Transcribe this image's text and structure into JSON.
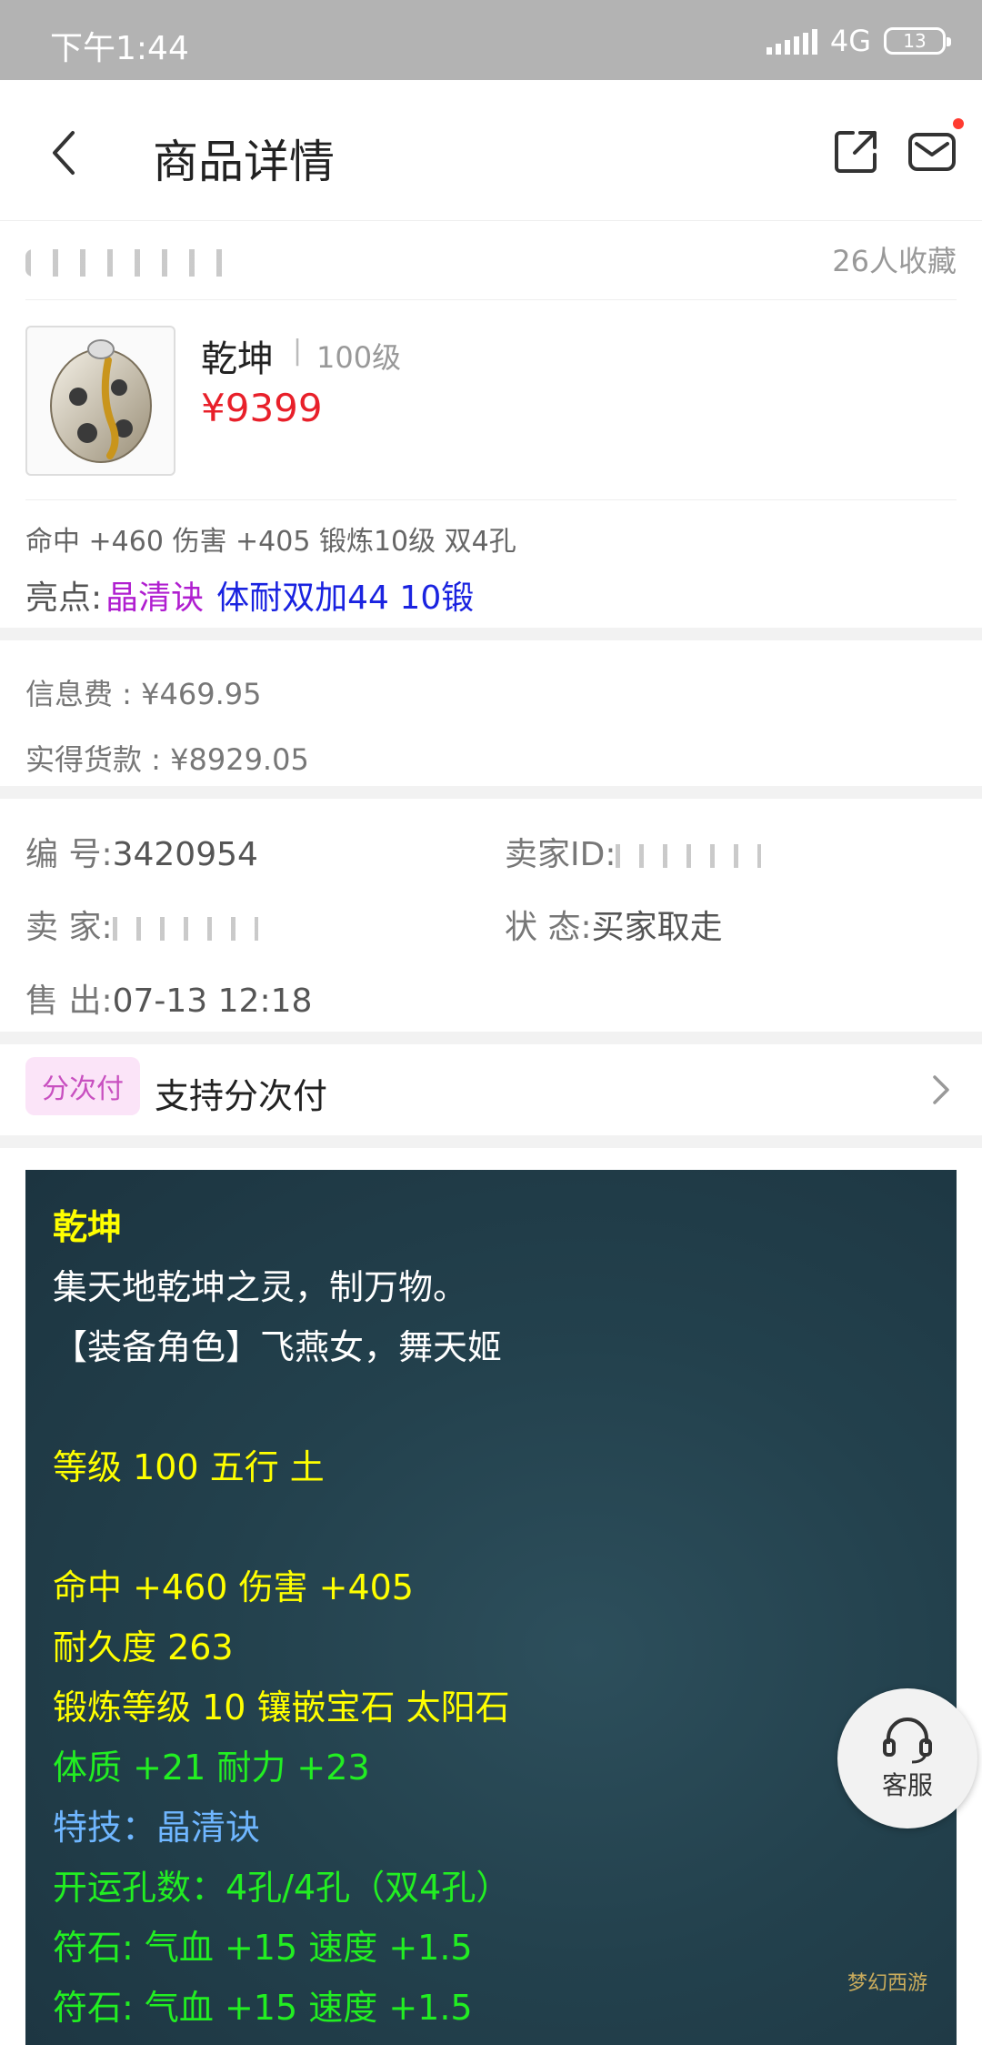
{
  "status_bar": {
    "time": "下午1:44",
    "network": "4G",
    "battery": "13"
  },
  "header": {
    "title": "商品详情"
  },
  "seller_row": {
    "favorites": "26人收藏"
  },
  "product": {
    "name": "乾坤",
    "separator": "|",
    "level": "100级",
    "price": "¥9399",
    "attributes": "命中 +460 伤害 +405 锻炼10级 双4孔",
    "highlights_label": "亮点:",
    "highlight_1": "晶清诀",
    "highlight_2": "体耐双加44 10锻"
  },
  "fees": {
    "info_fee": "信息费 : ¥469.95",
    "received": "实得货款 : ¥8929.05"
  },
  "info": {
    "number_label": "编  号:",
    "number": "3420954",
    "seller_id_label": "卖家ID:",
    "seller_label": "卖  家:",
    "status_label": "状  态:",
    "status": "买家取走",
    "sold_label": "售  出:",
    "sold": "07-13 12:18"
  },
  "installment": {
    "badge": "分次付",
    "text": "支持分次付"
  },
  "description": [
    {
      "text": "乾坤",
      "color": "yellow",
      "bold": true
    },
    {
      "text": "集天地乾坤之灵，制万物。",
      "color": "white"
    },
    {
      "text": "【装备角色】飞燕女，舞天姬",
      "color": "white"
    },
    {
      "text": "等级 100  五行 土",
      "color": "yellow"
    },
    {
      "text": "命中 +460 伤害 +405",
      "color": "yellow"
    },
    {
      "text": "耐久度 263",
      "color": "yellow"
    },
    {
      "text": "锻炼等级 10  镶嵌宝石 太阳石",
      "color": "yellow"
    },
    {
      "text": "体质 +21 耐力 +23",
      "color": "green"
    },
    {
      "text": "特技：晶清诀",
      "color": "blue"
    },
    {
      "text": "开运孔数：4孔/4孔（双4孔）",
      "color": "green"
    },
    {
      "text": "符石: 气血 +15 速度 +1.5",
      "color": "green"
    },
    {
      "text": "符石: 气血 +15 速度 +1.5",
      "color": "green"
    }
  ],
  "service": {
    "label": "客服"
  },
  "watermark": "梦幻西游"
}
